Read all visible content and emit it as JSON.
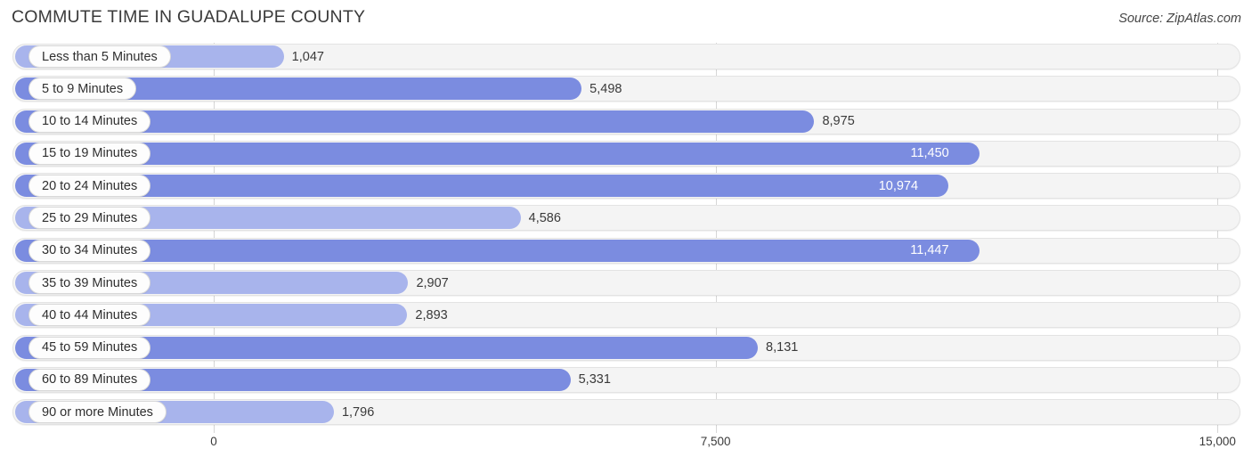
{
  "header": {
    "title": "COMMUTE TIME IN GUADALUPE COUNTY",
    "source": "Source: ZipAtlas.com"
  },
  "chart_data": {
    "type": "bar",
    "orientation": "horizontal",
    "title": "COMMUTE TIME IN GUADALUPE COUNTY",
    "xlabel": "",
    "ylabel": "",
    "xlim": [
      0,
      15000
    ],
    "grid": true,
    "legend": false,
    "axis_ticks": [
      "0",
      "7,500",
      "15,000"
    ],
    "axis_tick_values": [
      0,
      7500,
      15000
    ],
    "categories": [
      "Less than 5 Minutes",
      "5 to 9 Minutes",
      "10 to 14 Minutes",
      "15 to 19 Minutes",
      "20 to 24 Minutes",
      "25 to 29 Minutes",
      "30 to 34 Minutes",
      "35 to 39 Minutes",
      "40 to 44 Minutes",
      "45 to 59 Minutes",
      "60 to 89 Minutes",
      "90 or more Minutes"
    ],
    "values": [
      1047,
      5498,
      8975,
      11450,
      10974,
      4586,
      11447,
      2907,
      2893,
      8131,
      5331,
      1796
    ],
    "value_labels": [
      "1,047",
      "5,498",
      "8,975",
      "11,450",
      "10,974",
      "4,586",
      "11,447",
      "2,907",
      "2,893",
      "8,131",
      "5,331",
      "1,796"
    ],
    "bar_shades": [
      "light",
      "dark",
      "dark",
      "dark",
      "dark",
      "light",
      "dark",
      "light",
      "light",
      "dark",
      "dark",
      "light"
    ],
    "label_inside": [
      false,
      false,
      false,
      true,
      true,
      false,
      true,
      false,
      false,
      false,
      false,
      false
    ],
    "colors": {
      "bar_dark": "#7b8ce0",
      "bar_light": "#a8b4ec",
      "track": "#f4f4f4",
      "track_border": "#e3e3e3",
      "gridline": "#d6d6d6",
      "text": "#333333",
      "value_inside_text": "#ffffff"
    }
  }
}
